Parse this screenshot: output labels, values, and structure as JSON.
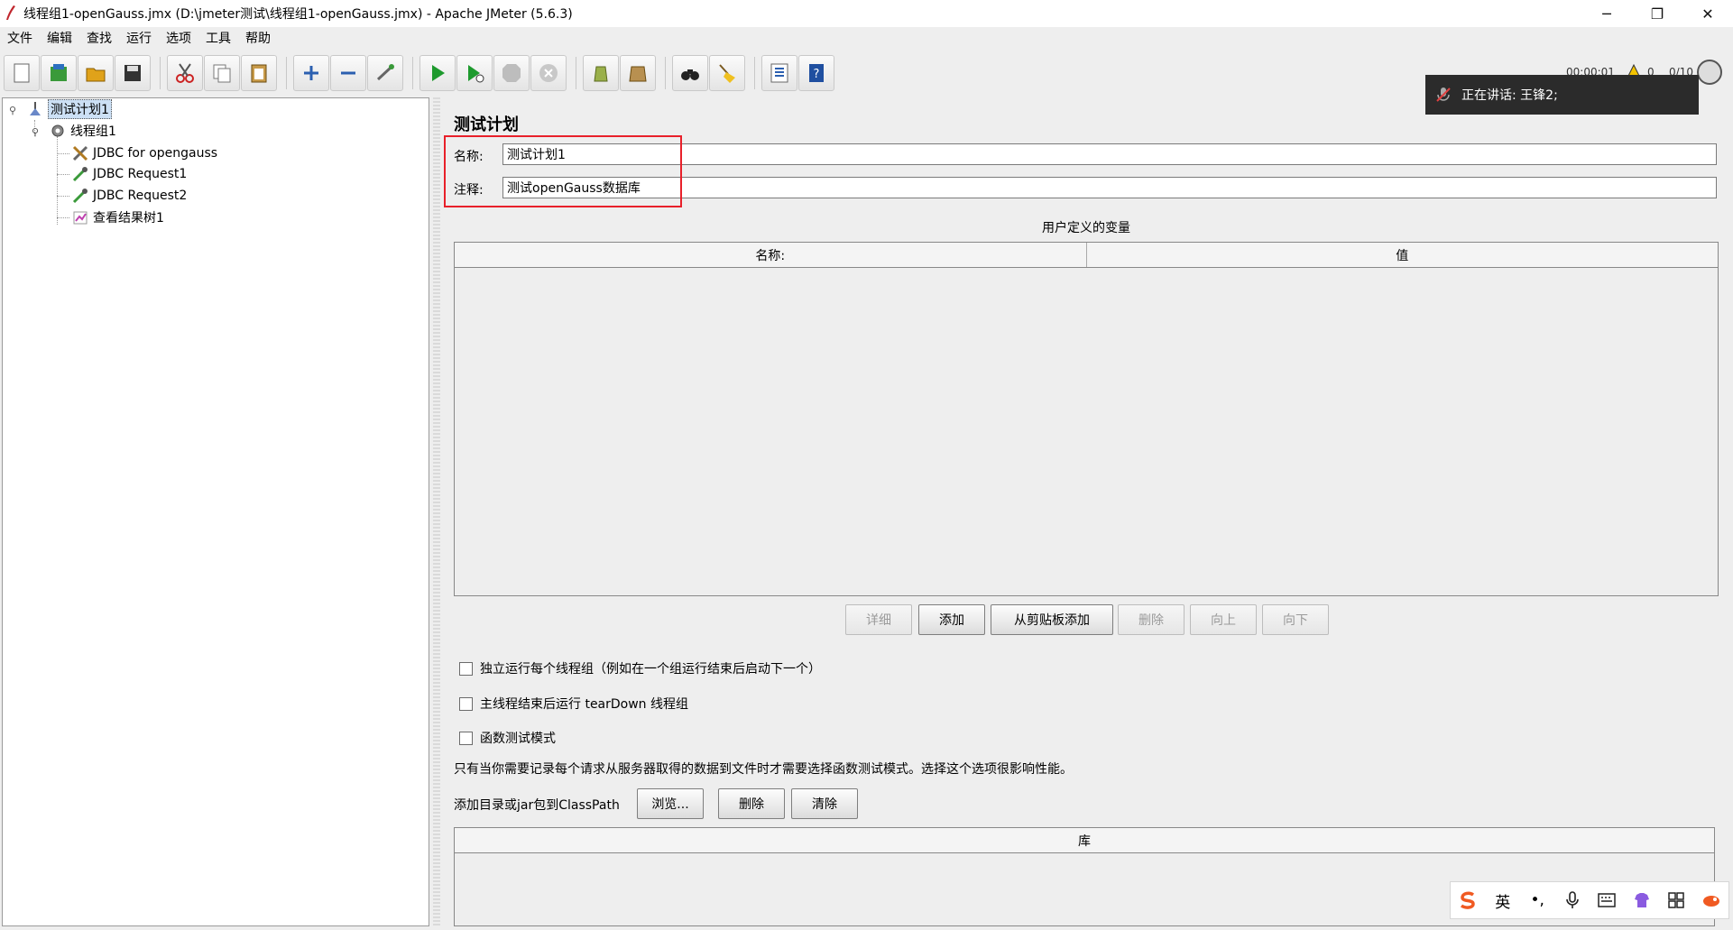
{
  "window": {
    "title": "线程组1-openGauss.jmx (D:\\jmeter测试\\线程组1-openGauss.jmx) - Apache JMeter (5.6.3)",
    "controls": [
      "─",
      "❐",
      "✕"
    ]
  },
  "menubar": [
    "文件",
    "编辑",
    "查找",
    "运行",
    "选项",
    "工具",
    "帮助"
  ],
  "toolbar": {
    "status_time": "00:00:01",
    "status_warn_count": "0",
    "status_threads": "0/10"
  },
  "tree": {
    "root": "测试计划1",
    "thread_group": "线程组1",
    "children": [
      "JDBC for opengauss",
      "JDBC Request1",
      "JDBC Request2",
      "查看结果树1"
    ]
  },
  "panel": {
    "title": "测试计划",
    "name_label": "名称:",
    "name_value": "测试计划1",
    "comment_label": "注释:",
    "comment_value": "测试openGauss数据库",
    "vars_title": "用户定义的变量",
    "vars_col_name": "名称:",
    "vars_col_value": "值",
    "buttons": {
      "detail": "详细",
      "add": "添加",
      "add_clipboard": "从剪贴板添加",
      "delete": "删除",
      "up": "向上",
      "down": "向下"
    },
    "checkboxes": {
      "serial": "独立运行每个线程组（例如在一个组运行结束后启动下一个）",
      "teardown": "主线程结束后运行 tearDown 线程组",
      "functional": "函数测试模式"
    },
    "note": "只有当你需要记录每个请求从服务器取得的数据到文件时才需要选择函数测试模式。选择这个选项很影响性能。",
    "classpath_label": "添加目录或jar包到ClassPath",
    "classpath_buttons": {
      "browse": "浏览...",
      "delete": "删除",
      "clear": "清除"
    },
    "lib_header": "库"
  },
  "notification": {
    "text": "正在讲话:  王锋2;"
  },
  "ime": {
    "lang": "英",
    "punct": "•,"
  },
  "colors": {
    "highlight_box": "#e8202a",
    "tree_selection": "#cce0f5",
    "notification_bg": "#2b2b2b"
  }
}
